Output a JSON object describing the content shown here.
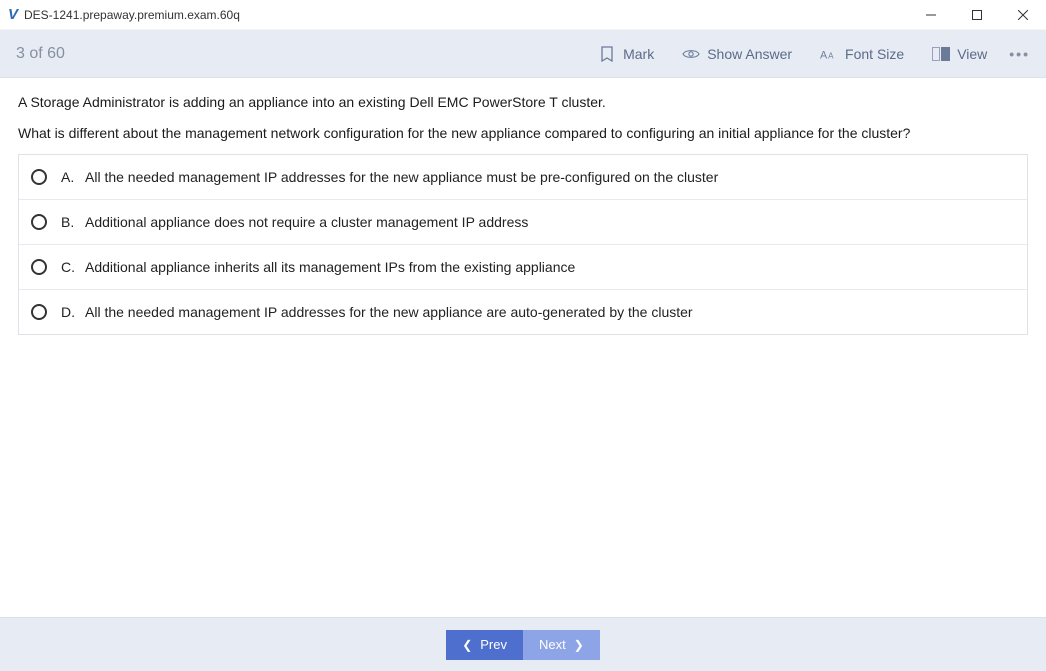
{
  "window": {
    "title": "DES-1241.prepaway.premium.exam.60q"
  },
  "toolbar": {
    "counter": "3 of 60",
    "mark": "Mark",
    "show_answer": "Show Answer",
    "font_size": "Font Size",
    "view": "View"
  },
  "question": {
    "line1": "A Storage Administrator is adding an appliance into an existing Dell EMC PowerStore T cluster.",
    "line2": "What is different about the management network configuration for the new appliance compared to configuring an initial appliance for the cluster?"
  },
  "options": [
    {
      "letter": "A.",
      "text": "All the needed management IP addresses for the new appliance must be pre-configured on the cluster"
    },
    {
      "letter": "B.",
      "text": "Additional appliance does not require a cluster management IP address"
    },
    {
      "letter": "C.",
      "text": "Additional appliance inherits all its management IPs from the existing appliance"
    },
    {
      "letter": "D.",
      "text": "All the needed management IP addresses for the new appliance are auto-generated by the cluster"
    }
  ],
  "footer": {
    "prev": "Prev",
    "next": "Next"
  }
}
